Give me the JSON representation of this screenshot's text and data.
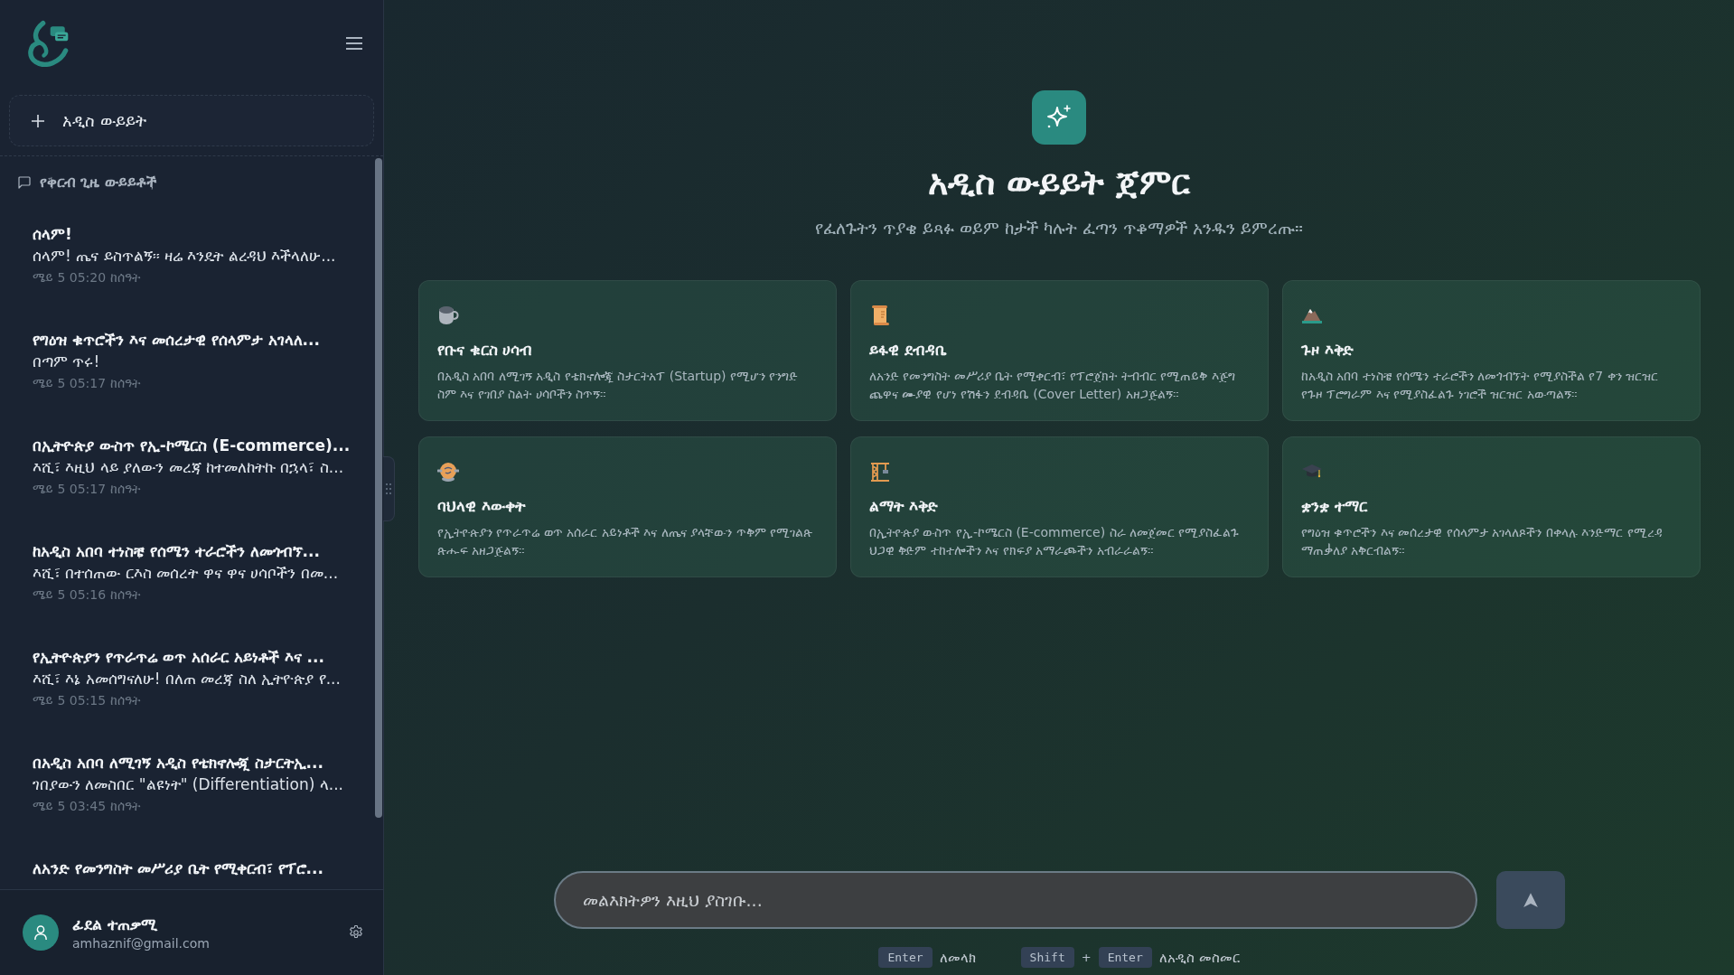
{
  "sidebar": {
    "new_chat": "አዲስ ውይይት",
    "recent_heading": "የቅርብ ጊዜ ውይይቶች",
    "conversations": [
      {
        "title": "ሰላም!",
        "preview": "ሰላም! ጤና ይስጥልኝ። ዛሬ እንዴት ልረዳህ እችላለሁ...",
        "time": "ሜይ 5 05:20 ከሰዓት"
      },
      {
        "title": "የግዕዝ ቁጥሮችን እና መሰረታዊ የሰላምታ አገላለ...",
        "preview": "በጣም ጥሩ!",
        "time": "ሜይ 5 05:17 ከሰዓት"
      },
      {
        "title": "በኢትዮጵያ ውስጥ የኢ-ኮሜርስ (E-commerce)...",
        "preview": "እሺ፣ እዚህ ላይ ያለውን መረጃ ከተመለከትኩ በኋላ፣ ስ...",
        "time": "ሜይ 5 05:17 ከሰዓት"
      },
      {
        "title": "ከአዲስ አበባ ተነስቼ የሰሜን ተራሮችን ለመጎብኘ...",
        "preview": "እሺ፣ በተሰጠው ርእስ መሰረት ዋና ዋና ሀሳቦችን በመ...",
        "time": "ሜይ 5 05:16 ከሰዓት"
      },
      {
        "title": "የኢትዮጵያን የጥራጥሬ ወጥ አሰራር አይነቶች እና ...",
        "preview": "እሺ፣ እኔ አመሰግናለሁ! በለጠ መረጃ ስለ ኢትዮጵያ የ...",
        "time": "ሜይ 5 05:15 ከሰዓት"
      },
      {
        "title": "በአዲስ አበባ ለሚገኝ አዲስ የቴክኖሎጂ ስታርትኢ...",
        "preview": "ገበያውን ለመስበር \"ልዩነት\" (Differentiation) ላ...",
        "time": "ሜይ 5 03:45 ከሰዓት"
      },
      {
        "title": "ለአንድ የመንግስት መሥሪያ ቤት የሚቀርብ፣ የፕሮ..."
      }
    ],
    "user": {
      "name": "ፊደል ተጠቃሚ",
      "email": "amhaznif@gmail.com"
    }
  },
  "welcome": {
    "title": "አዲስ ውይይት ጀምር",
    "subtitle": "የፈለጉትን ጥያቄ ይጻፉ ወይም ከታች ካሉት ፈጣን ጥቆማዎች አንዱን ይምረጡ።"
  },
  "suggestions": [
    {
      "title": "የቡና ቁርስ ሀሳብ",
      "description": "በአዲስ አበባ ለሚገኝ አዲስ የቴክኖሎጂ ስታርትአፕ (Startup) የሚሆን የንግድ ስም እና የገበያ ስልት ሀሳቦችን ስጥኝ።"
    },
    {
      "title": "ይፋዊ ደብዳቤ",
      "description": "ለአንድ የመንግስት መሥሪያ ቤት የሚቀርብ፣ የፕሮጀክት ትብብር የሚጠይቅ እጅግ ጨዋና ሙያዊ የሆነ የሽፋን ደብዳቤ (Cover Letter) አዘጋጅልኝ።"
    },
    {
      "title": "ጉዞ እቅድ",
      "description": "ከአዲስ አበባ ተነስቼ የሰሜን ተራሮችን ለመጎብኘት የሚያስችል የ7 ቀን ዝርዝር የጉዞ ፕሮግራም እና የሚያስፈልጉ ነገሮች ዝርዝር አውጣልኝ።"
    },
    {
      "title": "ባህላዊ እውቀት",
      "description": "የኢትዮጵያን የጥራጥሬ ወጥ አሰራር አይነቶች እና ለጤና ያላቸውን ጥቅም የሚገልጽ ጽሑፍ አዘጋጅልኝ።"
    },
    {
      "title": "ልማት እቅድ",
      "description": "በኢትዮጵያ ውስጥ የኢ-ኮሜርስ (E-commerce) ስራ ለመጀመር የሚያስፈልጉ ህጋዊ ቅድም ተከተሎችን እና የክፍያ አማራጮችን አብራራልኝ።"
    },
    {
      "title": "ቋንቋ ተማር",
      "description": "የግዕዝ ቁጥሮችን እና መሰረታዊ የሰላምታ አገላለጾችን በቀላሉ እንድማር የሚረዳ ማጠቃለያ አቅርብልኝ።"
    }
  ],
  "composer": {
    "placeholder": "መልእክትዎን እዚህ ያስገቡ..."
  },
  "hints": [
    {
      "keys": [
        "Enter"
      ],
      "text": "ለመላክ"
    },
    {
      "keys": [
        "Shift",
        "Enter"
      ],
      "joiner": "+",
      "text": "ለአዲስ መስመር"
    }
  ]
}
